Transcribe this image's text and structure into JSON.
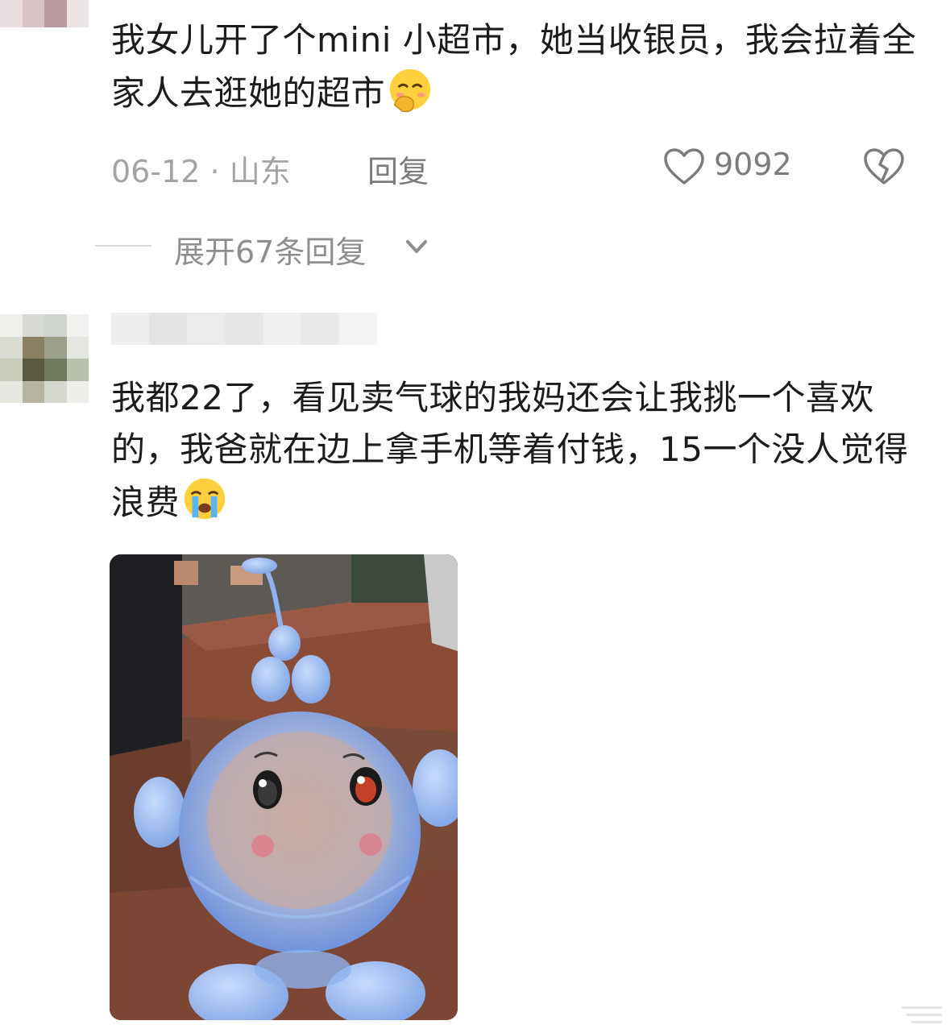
{
  "comments": [
    {
      "text": "我女儿开了个mini 小超市，她当收银员，我会拉着全家人去逛她的超市",
      "emoji": "shy-smiling-face-emoji",
      "date": "06-12",
      "separator": "·",
      "location": "山东",
      "reply_label": "回复",
      "like_count": "9092",
      "expand_label": "展开67条回复"
    },
    {
      "text": "我都22了，看见卖气球的我妈还会让我挑一个喜欢的，我爸就在边上拿手机等着付钱，15一个没人觉得浪费",
      "emoji": "loudly-crying-face-emoji",
      "image": "blue-balloon-doll-photo"
    }
  ],
  "icons": {
    "like": "heart-outline-icon",
    "dislike": "broken-heart-icon",
    "expand": "chevron-down-icon"
  },
  "colors": {
    "text": "#1c1c1c",
    "meta": "#a3a3a3",
    "balloon": "#8fb2ef"
  }
}
